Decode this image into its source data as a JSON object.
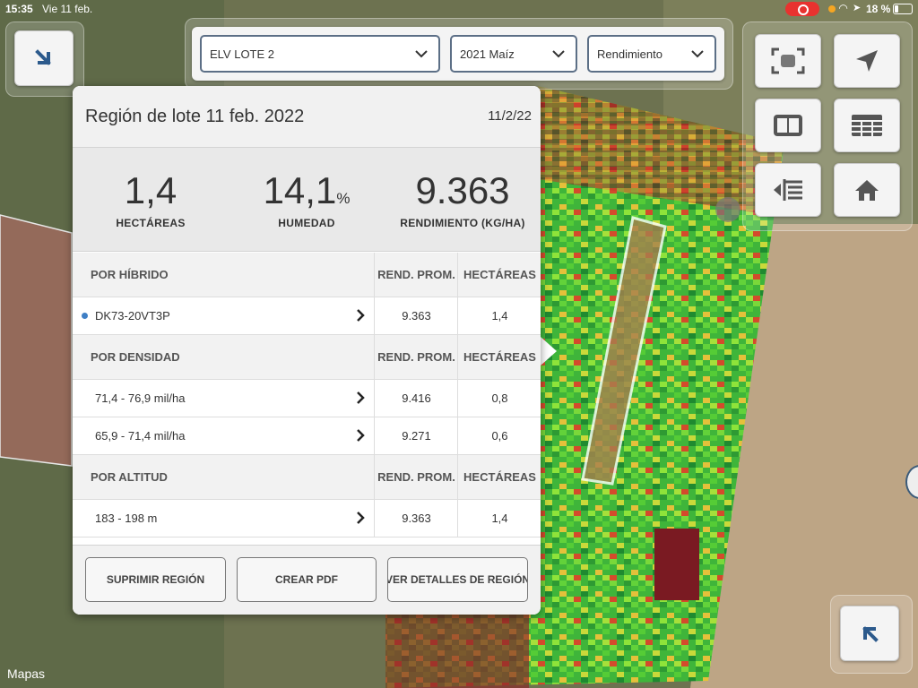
{
  "status_bar": {
    "time": "15:35",
    "date": "Vie 11 feb.",
    "battery": "18 %"
  },
  "filters": {
    "field": "ELV LOTE 2",
    "season": "2021 Maíz",
    "layer": "Rendimiento"
  },
  "panel": {
    "title": "Región de lote 11 feb. 2022",
    "date": "11/2/22",
    "stats": [
      {
        "value": "1,4",
        "unit": "",
        "label": "HECTÁREAS"
      },
      {
        "value": "14,1",
        "unit": "%",
        "label": "HUMEDAD"
      },
      {
        "value": "9.363",
        "unit": "",
        "label": "RENDIMIENTO (KG/HA)"
      }
    ],
    "sections": {
      "hybrid": {
        "title": "POR HÍBRIDO",
        "col_yield": "REND. PROM.",
        "col_area": "HECTÁREAS",
        "rows": [
          {
            "name": "DK73-20VT3P",
            "yield": "9.363",
            "area": "1,4",
            "color": "#3f7fc5"
          }
        ]
      },
      "density": {
        "title": "POR DENSIDAD",
        "col_yield": "REND. PROM.",
        "col_area": "HECTÁREAS",
        "rows": [
          {
            "name": "71,4 - 76,9 mil/ha",
            "yield": "9.416",
            "area": "0,8"
          },
          {
            "name": "65,9 - 71,4 mil/ha",
            "yield": "9.271",
            "area": "0,6"
          }
        ]
      },
      "altitude": {
        "title": "POR ALTITUD",
        "col_yield": "REND. PROM.",
        "col_area": "HECTÁREAS",
        "rows": [
          {
            "name": "183 - 198 m",
            "yield": "9.363",
            "area": "1,4"
          }
        ]
      }
    },
    "buttons": {
      "delete": "SUPRIMIR REGIÓN",
      "pdf": "CREAR PDF",
      "details": "VER DETALLES DE REGIÓN"
    }
  },
  "map_attribution": "Mapas",
  "map_tools": [
    "fit-extent-icon",
    "location-arrow-icon",
    "split-view-icon",
    "table-icon",
    "layers-icon",
    "home-icon"
  ]
}
